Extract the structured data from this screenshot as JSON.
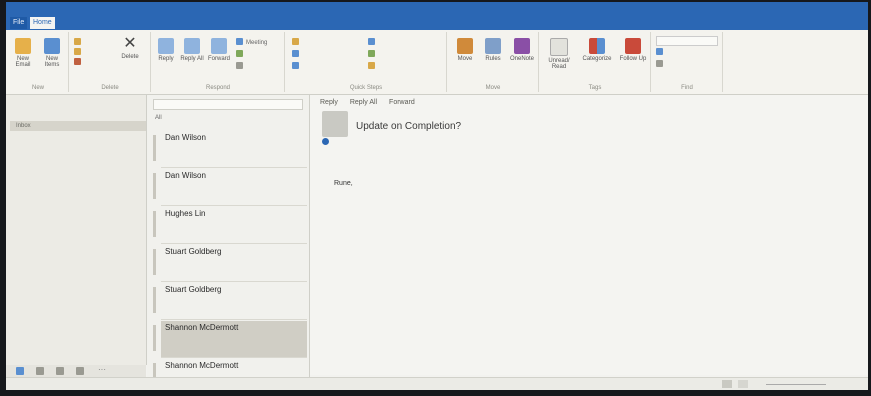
{
  "window": {
    "title": ""
  },
  "tabs": {
    "file": "File",
    "home": "Home",
    "others": [
      "",
      "",
      "",
      ""
    ],
    "tell_me": ""
  },
  "ribbon": {
    "groups": [
      {
        "label": "New"
      },
      {
        "label": "Delete"
      },
      {
        "label": "Respond"
      },
      {
        "label": "Quick Steps"
      },
      {
        "label": "Move"
      },
      {
        "label": "Tags"
      },
      {
        "label": "Find"
      }
    ],
    "buttons": {
      "new_email": "New Email",
      "new_items": "New Items",
      "delete": "Delete",
      "reply": "Reply",
      "reply_all": "Reply All",
      "forward": "Forward",
      "meeting": "Meeting",
      "move": "Move",
      "rules": "Rules",
      "onenote": "OneNote",
      "unread_read": "Unread/ Read",
      "categorize": "Categorize",
      "follow_up": "Follow Up",
      "search_people": "",
      "address_book": "",
      "filter_email": ""
    },
    "quick_steps": [
      "",
      "",
      "",
      "",
      "",
      ""
    ]
  },
  "folders": {
    "favorites_header": "",
    "favorites": [
      "Inbox",
      "",
      ""
    ],
    "account_header": "",
    "items": [
      "",
      "",
      "",
      "",
      "",
      "",
      "",
      "",
      "",
      "",
      "",
      "",
      "",
      ""
    ]
  },
  "message_list": {
    "search_placeholder": "",
    "filter_all": "All",
    "filter_unread": "",
    "sort": "",
    "messages": [
      {
        "from": "Dan Wilson",
        "subject": "",
        "preview": "",
        "date": ""
      },
      {
        "from": "Dan Wilson",
        "subject": "",
        "preview": "",
        "date": ""
      },
      {
        "from": "Hughes Lin",
        "subject": "",
        "preview": "",
        "date": ""
      },
      {
        "from": "Stuart Goldberg",
        "subject": "",
        "preview": "",
        "date": ""
      },
      {
        "from": "Stuart Goldberg",
        "subject": "",
        "preview": "",
        "date": ""
      },
      {
        "from": "Shannon McDermott",
        "subject": "",
        "preview": "",
        "date": ""
      },
      {
        "from": "Shannon McDermott",
        "subject": "",
        "preview": "",
        "date": ""
      }
    ]
  },
  "reading_pane": {
    "actions": [
      "Reply",
      "Reply All",
      "Forward"
    ],
    "sender": "",
    "subject": "Update on Completion?",
    "info": "",
    "greeting": "Rune,",
    "body": ""
  },
  "status_bar": {
    "left": "",
    "right": ""
  },
  "colors": {
    "accent": "#2b67b4",
    "selected_row": "#d0cec5"
  }
}
